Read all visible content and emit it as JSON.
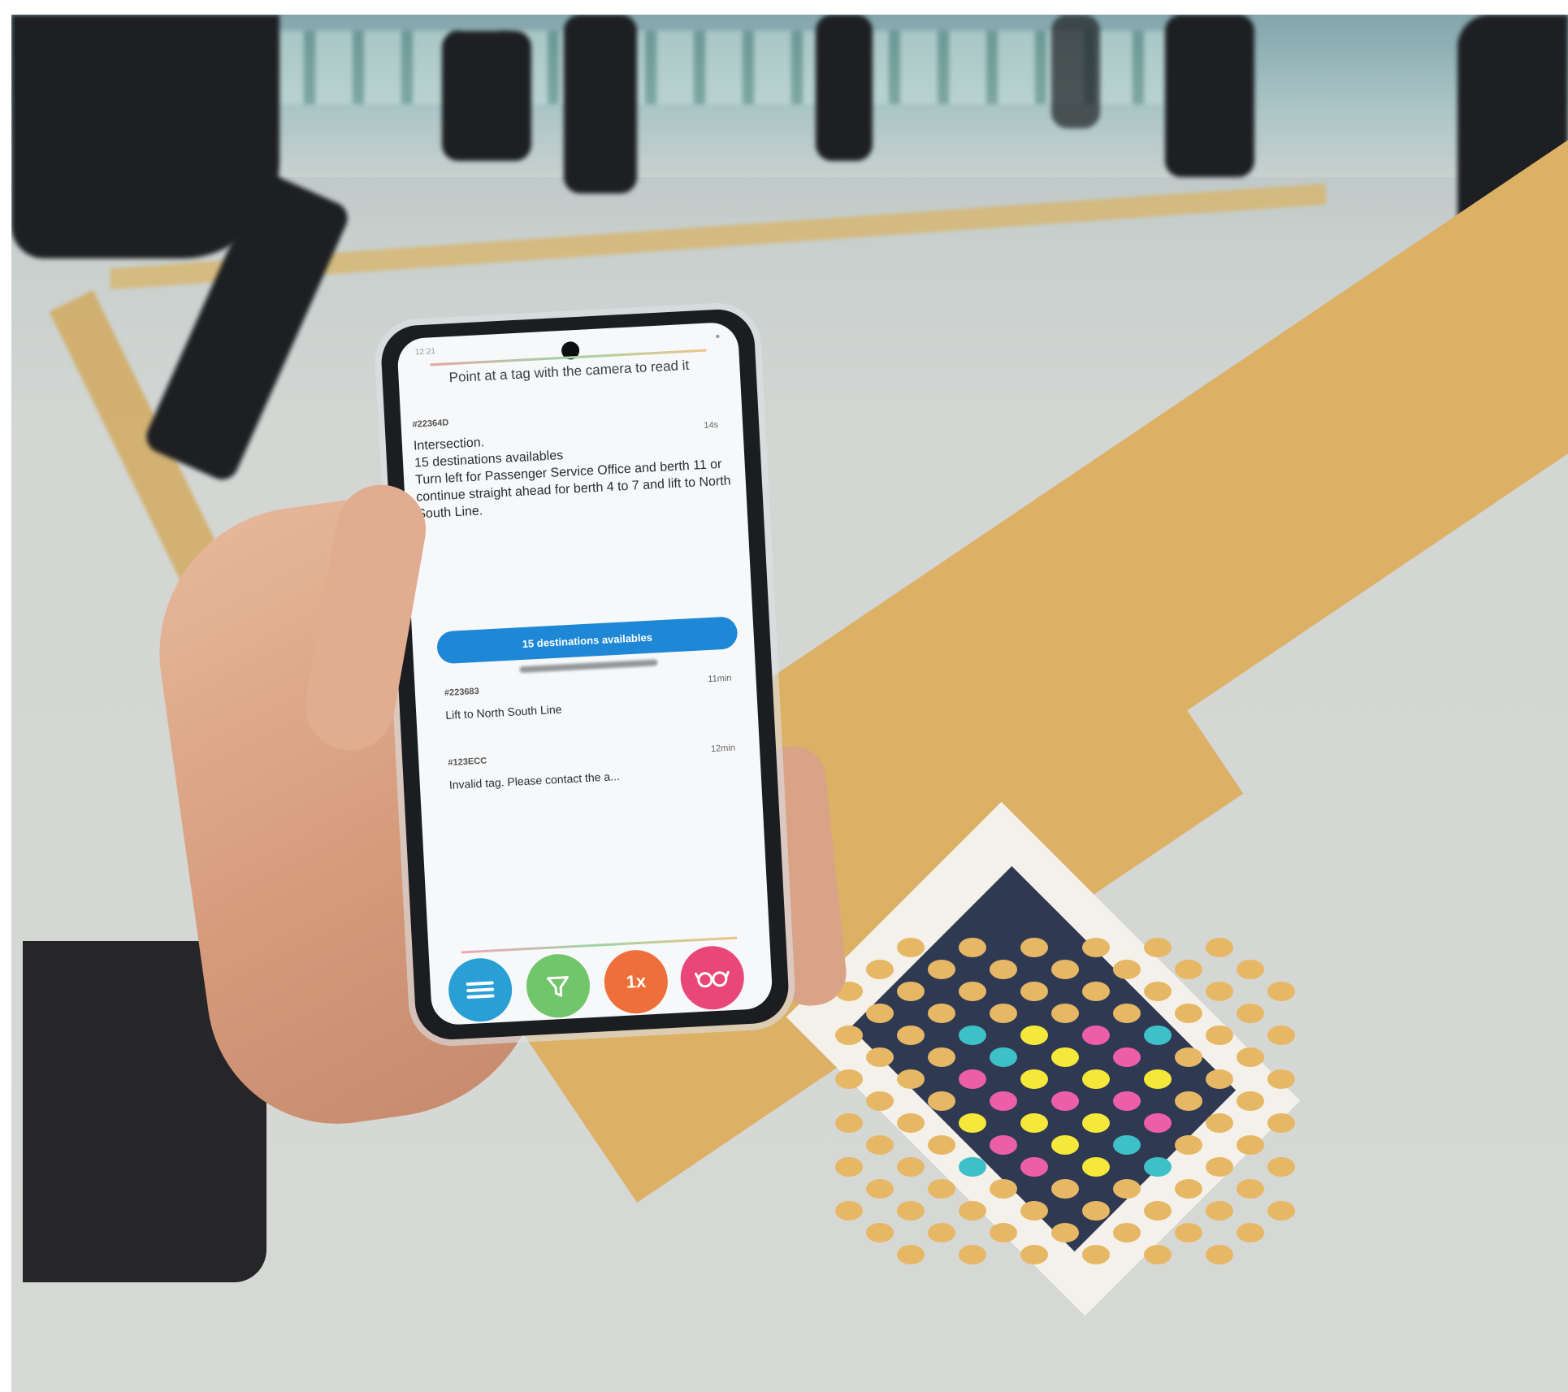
{
  "app": {
    "status_left": "12:21",
    "status_right": "●",
    "prompt": "Point at a tag with the camera to read it",
    "cards": [
      {
        "id": "#22364D",
        "time": "14s",
        "message": "Intersection.\n15 destinations availables\nTurn left for Passenger Service Office and berth 11 or continue straight ahead for berth 4 to 7 and lift to North South Line."
      },
      {
        "id": "#223683",
        "time": "11min",
        "message": "Lift to North South Line"
      },
      {
        "id": "#123ECC",
        "time": "12min",
        "message": "Invalid tag. Please contact the a..."
      }
    ],
    "destinations_button": "15 destinations availables",
    "toolbar": {
      "menu_icon": "menu-icon",
      "filter_icon": "filter-icon",
      "speed_label": "1x",
      "glasses_icon": "glasses-icon"
    }
  },
  "colors": {
    "primary_blue": "#1e88d6",
    "green": "#71c56b",
    "orange": "#ef6f3a",
    "pink": "#e9467a",
    "tactile_yellow": "#dcb065"
  }
}
